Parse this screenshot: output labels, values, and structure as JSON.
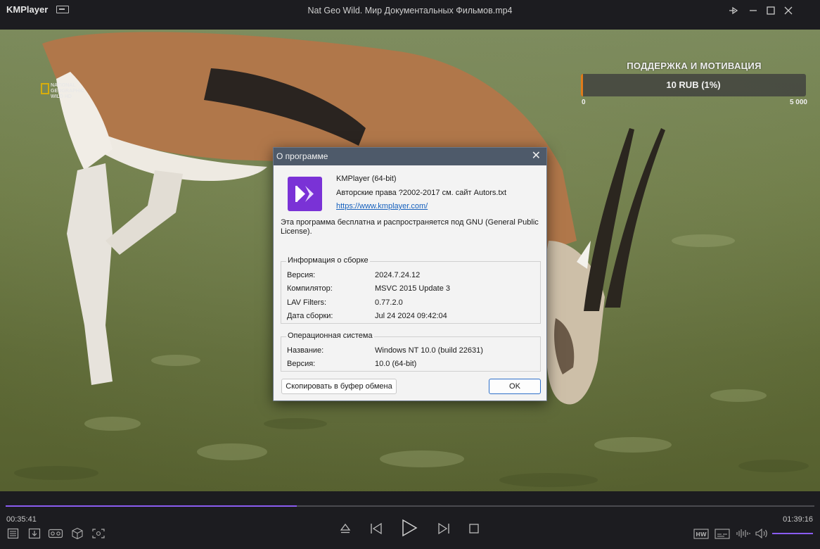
{
  "app": {
    "name": "KMPlayer",
    "window_title": "Nat Geo Wild. Мир Документальных Фильмов.mp4"
  },
  "video": {
    "channel_logo": "NATIONAL GEOGRAPHIC WILD HD"
  },
  "donation": {
    "title": "ПОДДЕРЖКА И МОТИВАЦИЯ",
    "amount": "10 RUB (1%)",
    "progress_percent": 1,
    "min": "0",
    "max": "5 000"
  },
  "about_dialog": {
    "title": "О программе",
    "product": "KMPlayer (64-bit)",
    "copyright": "Авторские права ?2002-2017 см. сайт Autors.txt",
    "website": "https://www.kmplayer.com/",
    "license": "Эта программа бесплатна и распространяется под GNU (General Public License).",
    "build_info": {
      "title": "Информация о сборке",
      "rows": [
        {
          "label": "Версия:",
          "value": "2024.7.24.12"
        },
        {
          "label": "Компилятор:",
          "value": "MSVC 2015 Update 3"
        },
        {
          "label": "LAV Filters:",
          "value": "0.77.2.0"
        },
        {
          "label": "Дата сборки:",
          "value": "Jul 24 2024 09:42:04"
        }
      ]
    },
    "os_info": {
      "title": "Операционная система",
      "rows": [
        {
          "label": "Название:",
          "value": "Windows NT 10.0 (build 22631)"
        },
        {
          "label": "Версия:",
          "value": "10.0 (64-bit)"
        }
      ]
    },
    "copy_button": "Скопировать в буфер обмена",
    "ok_button": "OK"
  },
  "playback": {
    "current_time": "00:35:41",
    "total_time": "01:39:16",
    "progress_fraction": 0.36,
    "volume_fraction": 1.0
  },
  "icons": {
    "left": [
      "playlist-icon",
      "download-icon",
      "vr-icon",
      "3d-cube-icon",
      "capture-icon"
    ],
    "center": [
      "eject-icon",
      "previous-icon",
      "play-icon",
      "next-icon",
      "stop-icon"
    ],
    "right": [
      "hw-accel-icon",
      "subtitle-icon",
      "equalizer-icon",
      "volume-icon"
    ]
  },
  "colors": {
    "accent": "#8a5cf0",
    "donation_fill": "#e07b1a",
    "dialog_titlebar": "#4e5a6a",
    "logo": "#7a32d6"
  }
}
